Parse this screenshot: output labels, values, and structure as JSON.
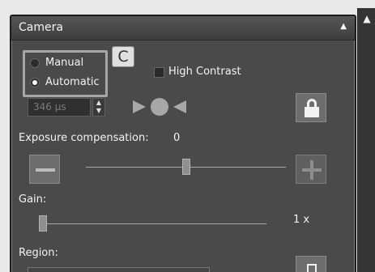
{
  "panel": {
    "title": "Camera"
  },
  "mode": {
    "options": [
      "Manual",
      "Automatic"
    ],
    "selected": "Automatic"
  },
  "callout": "C",
  "high_contrast": {
    "label": "High Contrast",
    "checked": false
  },
  "exposure": {
    "value": "346 µs"
  },
  "exposure_compensation": {
    "label": "Exposure compensation:",
    "value": "0",
    "slider_fraction": 0.5
  },
  "gain": {
    "label": "Gain:",
    "value": "1 x",
    "slider_fraction": 0.0
  },
  "region": {
    "label": "Region:"
  },
  "colors": {
    "panel_bg": "#4a4a4a",
    "title_bar": "#454545",
    "text": "#f3f3f3",
    "button_bg": "#6d6d6d",
    "callout_bg": "#e0e0e0"
  },
  "icons": {
    "scroll_up": "chevron-up-icon",
    "title_caret": "caret-up-icon",
    "lock": "lock-icon",
    "auto_exposure": "auto-exposure-icon",
    "minus": "minus-icon",
    "plus": "plus-icon",
    "region": "region-select-icon"
  }
}
